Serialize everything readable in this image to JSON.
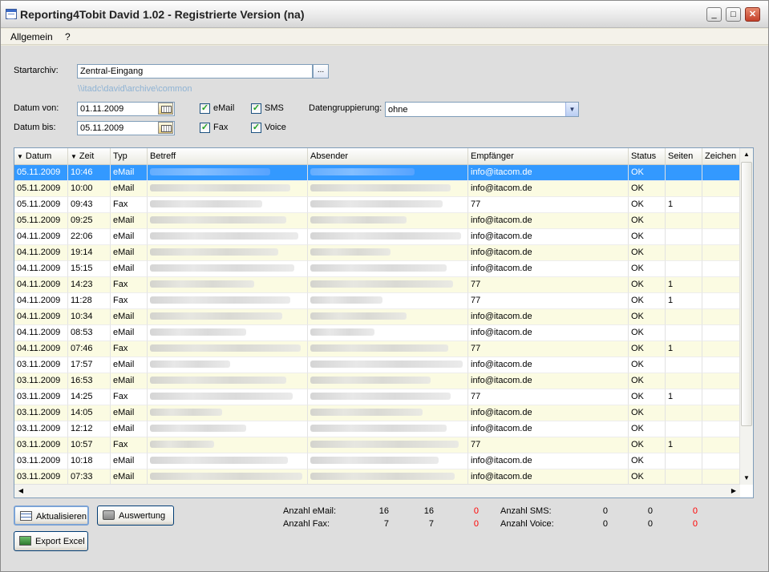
{
  "window": {
    "title": "Reporting4Tobit David 1.02 - Registrierte Version (na)",
    "buttons": {
      "minimize": "_",
      "maximize": "□",
      "close": "✕"
    }
  },
  "menu": [
    {
      "label": "Allgemein"
    },
    {
      "label": "?"
    }
  ],
  "form": {
    "startarchiv_label": "Startarchiv:",
    "startarchiv_value": "Zentral-Eingang",
    "browse_label": "...",
    "path": "\\\\itadc\\david\\archive\\common",
    "datum_von_label": "Datum von:",
    "datum_von_value": "01.11.2009",
    "datum_bis_label": "Datum bis:",
    "datum_bis_value": "05.11.2009",
    "checkboxes": {
      "email": {
        "label": "eMail",
        "checked": true
      },
      "sms": {
        "label": "SMS",
        "checked": true
      },
      "fax": {
        "label": "Fax",
        "checked": true
      },
      "voice": {
        "label": "Voice",
        "checked": true
      }
    },
    "gruppierung_label": "Datengruppierung:",
    "gruppierung_value": "ohne"
  },
  "table": {
    "columns": [
      "Datum",
      "Zeit",
      "Typ",
      "Betreff",
      "Absender",
      "Empfänger",
      "Status",
      "Seiten",
      "Zeichen"
    ],
    "rows": [
      {
        "datum": "05.11.2009",
        "zeit": "10:46",
        "typ": "eMail",
        "empfaenger": "info@itacom.de",
        "status": "OK",
        "seiten": ""
      },
      {
        "datum": "05.11.2009",
        "zeit": "10:00",
        "typ": "eMail",
        "empfaenger": "info@itacom.de",
        "status": "OK",
        "seiten": ""
      },
      {
        "datum": "05.11.2009",
        "zeit": "09:43",
        "typ": "Fax",
        "empfaenger": "77",
        "status": "OK",
        "seiten": "1"
      },
      {
        "datum": "05.11.2009",
        "zeit": "09:25",
        "typ": "eMail",
        "empfaenger": "info@itacom.de",
        "status": "OK",
        "seiten": ""
      },
      {
        "datum": "04.11.2009",
        "zeit": "22:06",
        "typ": "eMail",
        "empfaenger": "info@itacom.de",
        "status": "OK",
        "seiten": ""
      },
      {
        "datum": "04.11.2009",
        "zeit": "19:14",
        "typ": "eMail",
        "empfaenger": "info@itacom.de",
        "status": "OK",
        "seiten": ""
      },
      {
        "datum": "04.11.2009",
        "zeit": "15:15",
        "typ": "eMail",
        "empfaenger": "info@itacom.de",
        "status": "OK",
        "seiten": ""
      },
      {
        "datum": "04.11.2009",
        "zeit": "14:23",
        "typ": "Fax",
        "empfaenger": "77",
        "status": "OK",
        "seiten": "1"
      },
      {
        "datum": "04.11.2009",
        "zeit": "11:28",
        "typ": "Fax",
        "empfaenger": "77",
        "status": "OK",
        "seiten": "1"
      },
      {
        "datum": "04.11.2009",
        "zeit": "10:34",
        "typ": "eMail",
        "empfaenger": "info@itacom.de",
        "status": "OK",
        "seiten": ""
      },
      {
        "datum": "04.11.2009",
        "zeit": "08:53",
        "typ": "eMail",
        "empfaenger": "info@itacom.de",
        "status": "OK",
        "seiten": ""
      },
      {
        "datum": "04.11.2009",
        "zeit": "07:46",
        "typ": "Fax",
        "empfaenger": "77",
        "status": "OK",
        "seiten": "1"
      },
      {
        "datum": "03.11.2009",
        "zeit": "17:57",
        "typ": "eMail",
        "empfaenger": "info@itacom.de",
        "status": "OK",
        "seiten": ""
      },
      {
        "datum": "03.11.2009",
        "zeit": "16:53",
        "typ": "eMail",
        "empfaenger": "info@itacom.de",
        "status": "OK",
        "seiten": ""
      },
      {
        "datum": "03.11.2009",
        "zeit": "14:25",
        "typ": "Fax",
        "empfaenger": "77",
        "status": "OK",
        "seiten": "1"
      },
      {
        "datum": "03.11.2009",
        "zeit": "14:05",
        "typ": "eMail",
        "empfaenger": "info@itacom.de",
        "status": "OK",
        "seiten": ""
      },
      {
        "datum": "03.11.2009",
        "zeit": "12:12",
        "typ": "eMail",
        "empfaenger": "info@itacom.de",
        "status": "OK",
        "seiten": ""
      },
      {
        "datum": "03.11.2009",
        "zeit": "10:57",
        "typ": "Fax",
        "empfaenger": "77",
        "status": "OK",
        "seiten": "1"
      },
      {
        "datum": "03.11.2009",
        "zeit": "10:18",
        "typ": "eMail",
        "empfaenger": "info@itacom.de",
        "status": "OK",
        "seiten": ""
      },
      {
        "datum": "03.11.2009",
        "zeit": "07:33",
        "typ": "eMail",
        "empfaenger": "info@itacom.de",
        "status": "OK",
        "seiten": ""
      }
    ]
  },
  "buttons": {
    "aktualisieren": "Aktualisieren",
    "auswertung": "Auswertung",
    "export_excel": "Export Excel"
  },
  "stats": {
    "email": {
      "label": "Anzahl eMail:",
      "a": "16",
      "b": "16",
      "c": "0"
    },
    "fax": {
      "label": "Anzahl Fax:",
      "a": "7",
      "b": "7",
      "c": "0"
    },
    "sms": {
      "label": "Anzahl SMS:",
      "a": "0",
      "b": "0",
      "c": "0"
    },
    "voice": {
      "label": "Anzahl Voice:",
      "a": "0",
      "b": "0",
      "c": "0"
    }
  },
  "colors": {
    "selection": "#3399ff",
    "alt_row": "#fbfbe2",
    "zero_highlight": "#ff0000",
    "path_text": "#8fb3d4"
  }
}
